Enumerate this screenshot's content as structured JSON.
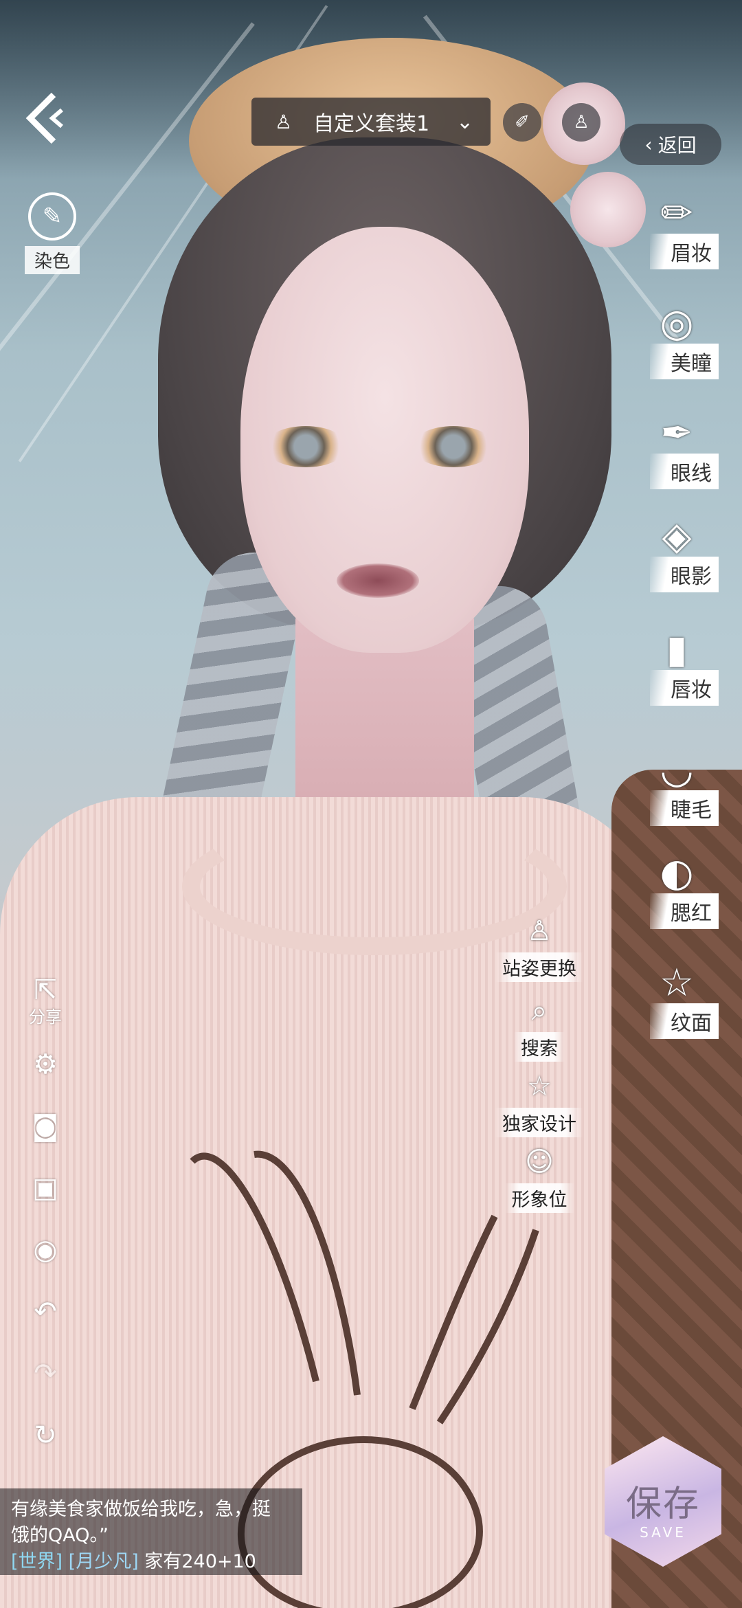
{
  "outfit_selector": {
    "name": "自定义套装1"
  },
  "top_right": {
    "return_label": "返回"
  },
  "dye": {
    "label": "染色"
  },
  "makeup_menu": [
    {
      "label": "眉妆",
      "icon": "brow-pencil-icon"
    },
    {
      "label": "美瞳",
      "icon": "contact-lens-icon"
    },
    {
      "label": "眼线",
      "icon": "eyeliner-icon"
    },
    {
      "label": "眼影",
      "icon": "eyeshadow-palette-icon"
    },
    {
      "label": "唇妆",
      "icon": "lipstick-icon"
    },
    {
      "label": "睫毛",
      "icon": "eyelash-icon"
    },
    {
      "label": "腮红",
      "icon": "blush-compact-icon"
    },
    {
      "label": "纹面",
      "icon": "stars-icon"
    }
  ],
  "left_toolbar": {
    "share_label": "分享"
  },
  "mid_menu": [
    {
      "label": "站姿更换",
      "icon": "person-stand-icon"
    },
    {
      "label": "搜索",
      "icon": "search-icon"
    },
    {
      "label": "独家设计",
      "icon": "star-outline-icon"
    },
    {
      "label": "形象位",
      "icon": "portrait-icon"
    }
  ],
  "chat": {
    "line1": "有缘美食家做饭给我吃，急，挺",
    "line2": "饿的QAQ。”",
    "channel": "[世界]",
    "user": "[月少凡]",
    "message": "家有240+10"
  },
  "save_button": {
    "label": "保存",
    "sub": "SAVE"
  }
}
